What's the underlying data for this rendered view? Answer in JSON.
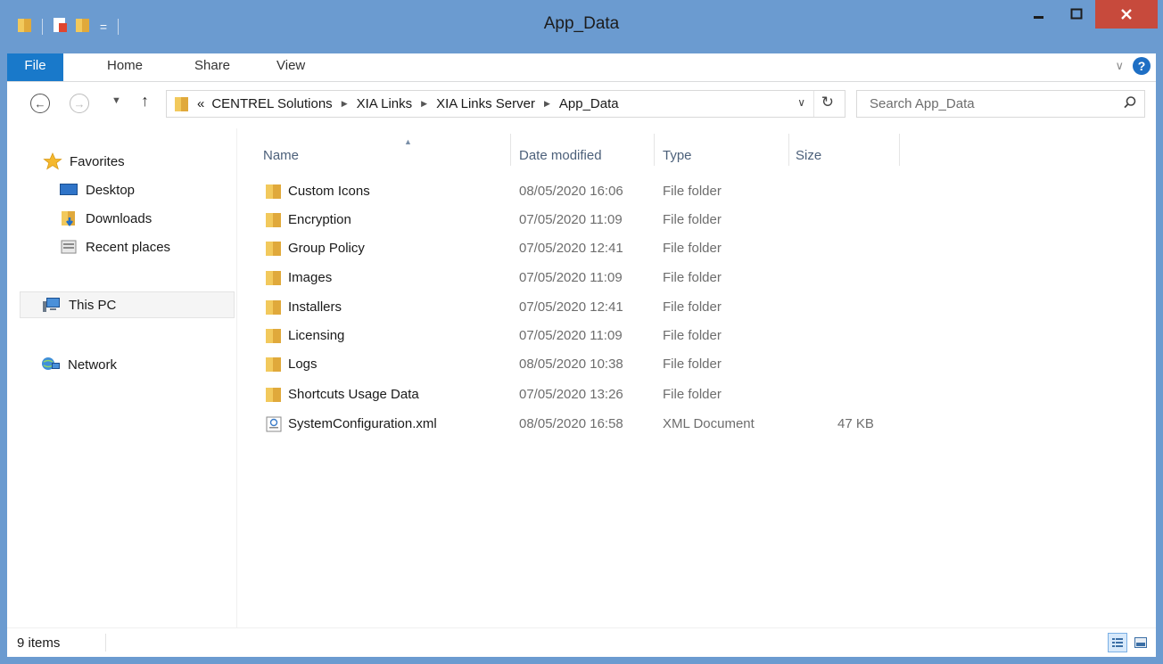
{
  "window": {
    "title": "App_Data"
  },
  "ribbon": {
    "tabs": [
      "File",
      "Home",
      "Share",
      "View"
    ]
  },
  "navigation": {
    "breadcrumb_overflow": "«",
    "breadcrumbs": [
      "CENTREL Solutions",
      "XIA Links",
      "XIA Links Server",
      "App_Data"
    ],
    "search_placeholder": "Search App_Data"
  },
  "sidebar": {
    "favorites": {
      "label": "Favorites",
      "items": [
        "Desktop",
        "Downloads",
        "Recent places"
      ]
    },
    "this_pc": "This PC",
    "network": "Network"
  },
  "file_list": {
    "columns": [
      "Name",
      "Date modified",
      "Type",
      "Size"
    ],
    "rows": [
      {
        "name": "Custom Icons",
        "date": "08/05/2020 16:06",
        "type": "File folder",
        "size": "",
        "icon": "folder-icon"
      },
      {
        "name": "Encryption",
        "date": "07/05/2020 11:09",
        "type": "File folder",
        "size": "",
        "icon": "folder-icon"
      },
      {
        "name": "Group Policy",
        "date": "07/05/2020 12:41",
        "type": "File folder",
        "size": "",
        "icon": "folder-icon"
      },
      {
        "name": "Images",
        "date": "07/05/2020 11:09",
        "type": "File folder",
        "size": "",
        "icon": "folder-icon"
      },
      {
        "name": "Installers",
        "date": "07/05/2020 12:41",
        "type": "File folder",
        "size": "",
        "icon": "folder-icon"
      },
      {
        "name": "Licensing",
        "date": "07/05/2020 11:09",
        "type": "File folder",
        "size": "",
        "icon": "folder-icon"
      },
      {
        "name": "Logs",
        "date": "08/05/2020 10:38",
        "type": "File folder",
        "size": "",
        "icon": "folder-icon"
      },
      {
        "name": "Shortcuts Usage Data",
        "date": "07/05/2020 13:26",
        "type": "File folder",
        "size": "",
        "icon": "folder-icon"
      },
      {
        "name": "SystemConfiguration.xml",
        "date": "08/05/2020 16:58",
        "type": "XML Document",
        "size": "47 KB",
        "icon": "xml-file-icon"
      }
    ]
  },
  "status": {
    "item_count": "9 items"
  },
  "colors": {
    "frame": "#6b9bd0",
    "file_tab": "#1979ca",
    "close_button": "#c74a3c",
    "folder": "#e8b94a"
  }
}
